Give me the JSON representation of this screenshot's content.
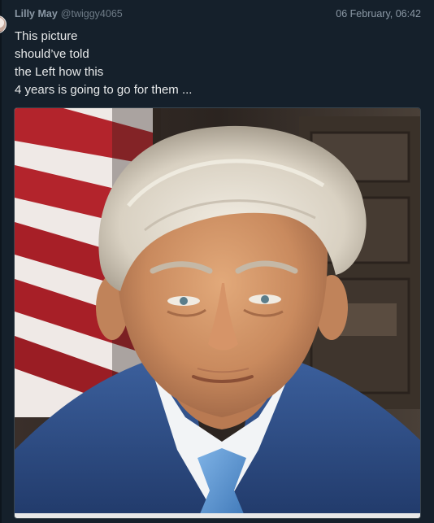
{
  "post": {
    "author_name": "Lilly May",
    "author_handle": "@twiggy4065",
    "timestamp": "06 February, 06:42",
    "text_lines": [
      "This picture",
      "should’ve told",
      "the Left how this",
      "4 years is going to go for them ..."
    ]
  },
  "colors": {
    "background": "#15202b",
    "primary_text": "#e7e9ea",
    "secondary_text": "#8b98a5",
    "border": "#38444d"
  }
}
